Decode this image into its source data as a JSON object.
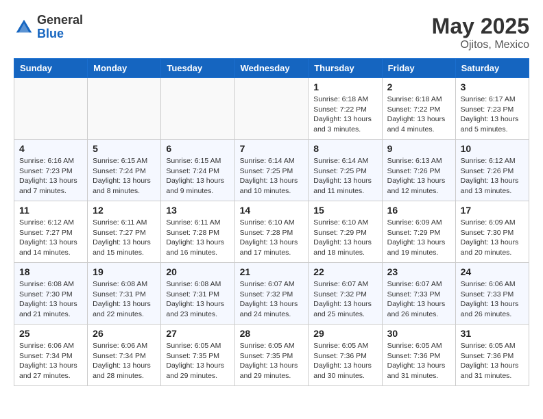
{
  "header": {
    "logo_line1": "General",
    "logo_line2": "Blue",
    "month_year": "May 2025",
    "location": "Ojitos, Mexico"
  },
  "weekdays": [
    "Sunday",
    "Monday",
    "Tuesday",
    "Wednesday",
    "Thursday",
    "Friday",
    "Saturday"
  ],
  "weeks": [
    [
      {
        "day": "",
        "info": ""
      },
      {
        "day": "",
        "info": ""
      },
      {
        "day": "",
        "info": ""
      },
      {
        "day": "",
        "info": ""
      },
      {
        "day": "1",
        "info": "Sunrise: 6:18 AM\nSunset: 7:22 PM\nDaylight: 13 hours\nand 3 minutes."
      },
      {
        "day": "2",
        "info": "Sunrise: 6:18 AM\nSunset: 7:22 PM\nDaylight: 13 hours\nand 4 minutes."
      },
      {
        "day": "3",
        "info": "Sunrise: 6:17 AM\nSunset: 7:23 PM\nDaylight: 13 hours\nand 5 minutes."
      }
    ],
    [
      {
        "day": "4",
        "info": "Sunrise: 6:16 AM\nSunset: 7:23 PM\nDaylight: 13 hours\nand 7 minutes."
      },
      {
        "day": "5",
        "info": "Sunrise: 6:15 AM\nSunset: 7:24 PM\nDaylight: 13 hours\nand 8 minutes."
      },
      {
        "day": "6",
        "info": "Sunrise: 6:15 AM\nSunset: 7:24 PM\nDaylight: 13 hours\nand 9 minutes."
      },
      {
        "day": "7",
        "info": "Sunrise: 6:14 AM\nSunset: 7:25 PM\nDaylight: 13 hours\nand 10 minutes."
      },
      {
        "day": "8",
        "info": "Sunrise: 6:14 AM\nSunset: 7:25 PM\nDaylight: 13 hours\nand 11 minutes."
      },
      {
        "day": "9",
        "info": "Sunrise: 6:13 AM\nSunset: 7:26 PM\nDaylight: 13 hours\nand 12 minutes."
      },
      {
        "day": "10",
        "info": "Sunrise: 6:12 AM\nSunset: 7:26 PM\nDaylight: 13 hours\nand 13 minutes."
      }
    ],
    [
      {
        "day": "11",
        "info": "Sunrise: 6:12 AM\nSunset: 7:27 PM\nDaylight: 13 hours\nand 14 minutes."
      },
      {
        "day": "12",
        "info": "Sunrise: 6:11 AM\nSunset: 7:27 PM\nDaylight: 13 hours\nand 15 minutes."
      },
      {
        "day": "13",
        "info": "Sunrise: 6:11 AM\nSunset: 7:28 PM\nDaylight: 13 hours\nand 16 minutes."
      },
      {
        "day": "14",
        "info": "Sunrise: 6:10 AM\nSunset: 7:28 PM\nDaylight: 13 hours\nand 17 minutes."
      },
      {
        "day": "15",
        "info": "Sunrise: 6:10 AM\nSunset: 7:29 PM\nDaylight: 13 hours\nand 18 minutes."
      },
      {
        "day": "16",
        "info": "Sunrise: 6:09 AM\nSunset: 7:29 PM\nDaylight: 13 hours\nand 19 minutes."
      },
      {
        "day": "17",
        "info": "Sunrise: 6:09 AM\nSunset: 7:30 PM\nDaylight: 13 hours\nand 20 minutes."
      }
    ],
    [
      {
        "day": "18",
        "info": "Sunrise: 6:08 AM\nSunset: 7:30 PM\nDaylight: 13 hours\nand 21 minutes."
      },
      {
        "day": "19",
        "info": "Sunrise: 6:08 AM\nSunset: 7:31 PM\nDaylight: 13 hours\nand 22 minutes."
      },
      {
        "day": "20",
        "info": "Sunrise: 6:08 AM\nSunset: 7:31 PM\nDaylight: 13 hours\nand 23 minutes."
      },
      {
        "day": "21",
        "info": "Sunrise: 6:07 AM\nSunset: 7:32 PM\nDaylight: 13 hours\nand 24 minutes."
      },
      {
        "day": "22",
        "info": "Sunrise: 6:07 AM\nSunset: 7:32 PM\nDaylight: 13 hours\nand 25 minutes."
      },
      {
        "day": "23",
        "info": "Sunrise: 6:07 AM\nSunset: 7:33 PM\nDaylight: 13 hours\nand 26 minutes."
      },
      {
        "day": "24",
        "info": "Sunrise: 6:06 AM\nSunset: 7:33 PM\nDaylight: 13 hours\nand 26 minutes."
      }
    ],
    [
      {
        "day": "25",
        "info": "Sunrise: 6:06 AM\nSunset: 7:34 PM\nDaylight: 13 hours\nand 27 minutes."
      },
      {
        "day": "26",
        "info": "Sunrise: 6:06 AM\nSunset: 7:34 PM\nDaylight: 13 hours\nand 28 minutes."
      },
      {
        "day": "27",
        "info": "Sunrise: 6:05 AM\nSunset: 7:35 PM\nDaylight: 13 hours\nand 29 minutes."
      },
      {
        "day": "28",
        "info": "Sunrise: 6:05 AM\nSunset: 7:35 PM\nDaylight: 13 hours\nand 29 minutes."
      },
      {
        "day": "29",
        "info": "Sunrise: 6:05 AM\nSunset: 7:36 PM\nDaylight: 13 hours\nand 30 minutes."
      },
      {
        "day": "30",
        "info": "Sunrise: 6:05 AM\nSunset: 7:36 PM\nDaylight: 13 hours\nand 31 minutes."
      },
      {
        "day": "31",
        "info": "Sunrise: 6:05 AM\nSunset: 7:36 PM\nDaylight: 13 hours\nand 31 minutes."
      }
    ]
  ]
}
